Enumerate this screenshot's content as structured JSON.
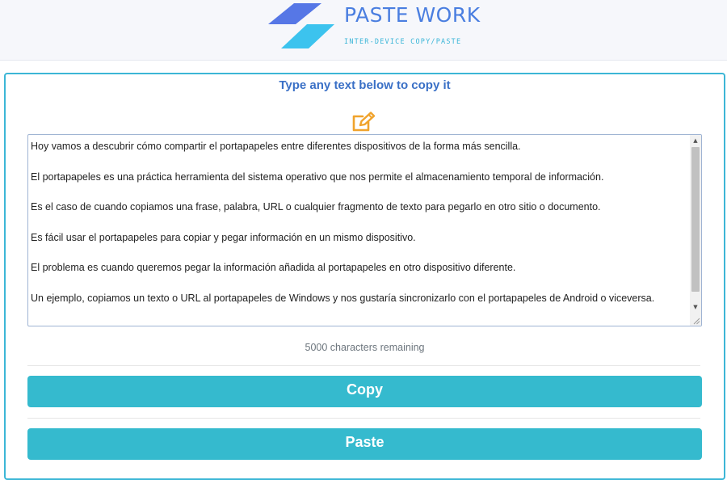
{
  "header": {
    "brand_name": "PASTE WORK",
    "tagline": "INTER-DEVICE COPY/PASTE",
    "logo_icon": "paste-work-logo",
    "colors": {
      "brand_dark": "#5677e6",
      "brand_light": "#3cc3ee",
      "title": "#4a7ee0"
    }
  },
  "main": {
    "title": "Type any text below to copy it",
    "edit_icon": "edit-icon",
    "textarea": {
      "lines": [
        "Hoy vamos a descubrir cómo compartir el portapapeles entre diferentes dispositivos de la forma más sencilla.",
        "El portapapeles es una práctica herramienta del sistema operativo que nos permite el almacenamiento temporal de información.",
        "Es el caso de cuando copiamos una frase, palabra, URL o cualquier fragmento de texto para pegarlo en otro sitio o documento.",
        "Es fácil usar el portapapeles para copiar y pegar información en un mismo dispositivo.",
        "El problema es cuando queremos pegar la información añadida al portapapeles en otro dispositivo diferente.",
        "Un ejemplo, copiamos un texto o URL al portapapeles de Windows y nos gustaría sincronizarlo con el portapapeles de Android o viceversa."
      ]
    },
    "counter": "5000 characters remaining",
    "copy_label": "Copy",
    "paste_label": "Paste",
    "colors": {
      "accent": "#35bace",
      "title": "#3a70c6",
      "edit_icon": "#f0a32c"
    }
  }
}
